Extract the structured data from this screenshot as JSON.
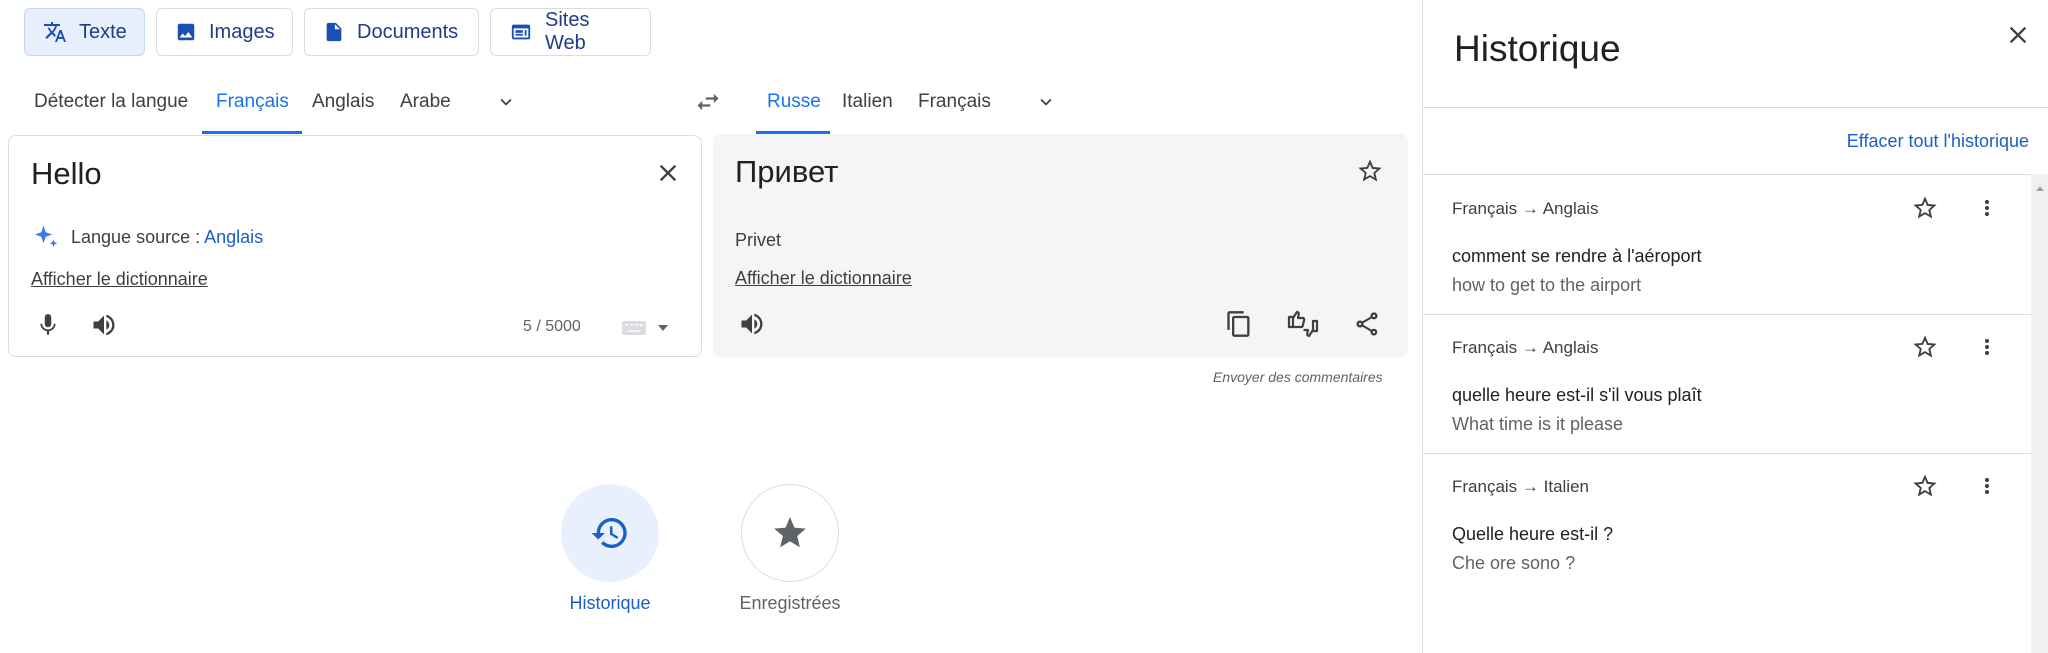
{
  "mode_tabs": [
    {
      "label": "Texte"
    },
    {
      "label": "Images"
    },
    {
      "label": "Documents"
    },
    {
      "label": "Sites Web"
    }
  ],
  "source_langs": {
    "detect": "Détecter la langue",
    "items": [
      "Français",
      "Anglais",
      "Arabe"
    ],
    "active": "Français"
  },
  "target_langs": {
    "items": [
      "Russe",
      "Italien",
      "Français"
    ],
    "active": "Russe"
  },
  "source": {
    "text": "Hello",
    "detected_prefix": "Langue source : ",
    "detected_lang": "Anglais",
    "dict_link": "Afficher le dictionnaire",
    "char_count": "5 / 5000"
  },
  "target": {
    "text": "Привет",
    "transliteration": "Privet",
    "dict_link": "Afficher le dictionnaire"
  },
  "feedback": "Envoyer des commentaires",
  "bottom": {
    "history_label": "Historique",
    "saved_label": "Enregistrées"
  },
  "history_panel": {
    "title": "Historique",
    "clear_all": "Effacer tout l'historique",
    "items": [
      {
        "langs": "Français → Anglais",
        "source": "comment se rendre à l'aéroport",
        "target": "how to get to the airport"
      },
      {
        "langs": "Français → Anglais",
        "source": "quelle heure est-il s'il vous plaît",
        "target": "What time is it please"
      },
      {
        "langs": "Français → Italien",
        "source": "Quelle heure est-il ?",
        "target": "Che ore sono ?"
      }
    ]
  },
  "colors": {
    "accent": "#1a73e8",
    "active_tab_bg": "#e8f0fe",
    "target_panel_bg": "#f5f5f5"
  }
}
